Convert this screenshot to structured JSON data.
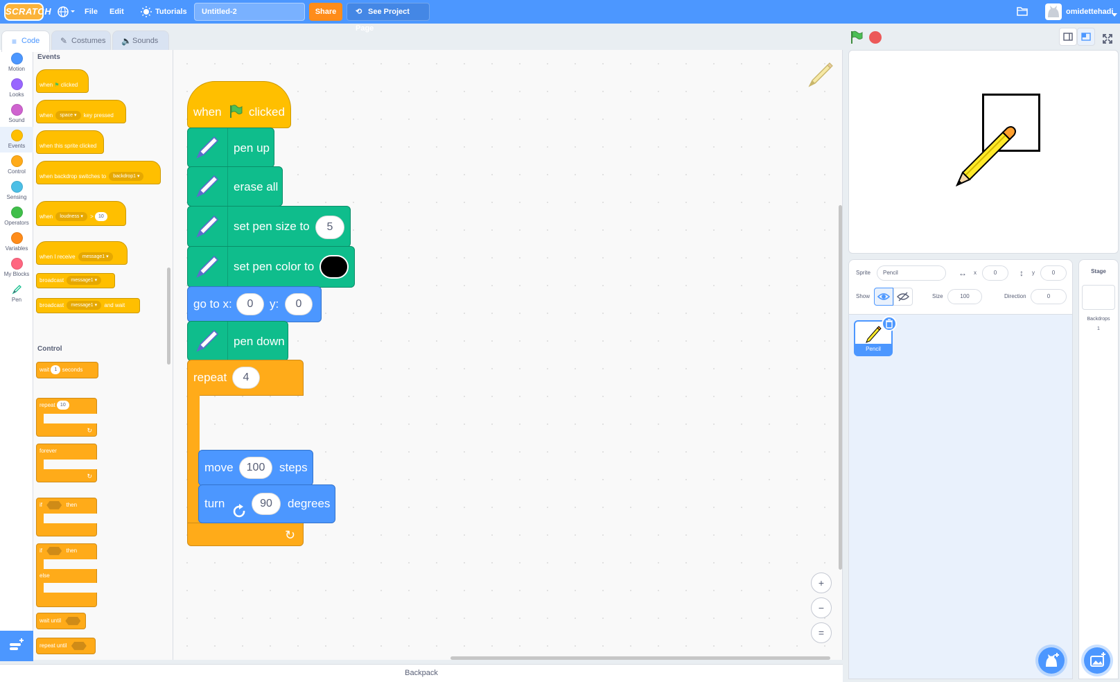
{
  "menu": {
    "logo": "SCRATCH",
    "file": "File",
    "edit": "Edit",
    "tutorials": "Tutorials",
    "project_title": "Untitled-2",
    "share": "Share",
    "see_project": "See Project Page",
    "username": "omidettehadi"
  },
  "tabs": {
    "code": "Code",
    "costumes": "Costumes",
    "sounds": "Sounds"
  },
  "categories": [
    {
      "label": "Motion",
      "color": "#4c97ff"
    },
    {
      "label": "Looks",
      "color": "#9966ff"
    },
    {
      "label": "Sound",
      "color": "#cf63cf"
    },
    {
      "label": "Events",
      "color": "#ffbf00"
    },
    {
      "label": "Control",
      "color": "#ffab19"
    },
    {
      "label": "Sensing",
      "color": "#4cbfe6"
    },
    {
      "label": "Operators",
      "color": "#40bf4a"
    },
    {
      "label": "Variables",
      "color": "#ff8c1a"
    },
    {
      "label": "My Blocks",
      "color": "#ff6680"
    },
    {
      "label": "Pen",
      "color": "#0fbd8c"
    }
  ],
  "palette": {
    "events_header": "Events",
    "control_header": "Control",
    "when": "when",
    "clicked": "clicked",
    "space": "space",
    "key_pressed": "key pressed",
    "when_sprite_clicked": "when this sprite clicked",
    "when_backdrop": "when backdrop switches to",
    "backdrop1": "backdrop1",
    "loudness": "loudness",
    "gt": ">",
    "ten": "10",
    "when_receive": "when I receive",
    "message1": "message1",
    "broadcast": "broadcast",
    "and_wait": "and wait",
    "wait": "wait",
    "one": "1",
    "seconds": "seconds",
    "repeat": "repeat",
    "forever": "forever",
    "if": "if",
    "then": "then",
    "else": "else",
    "wait_until": "wait until",
    "repeat_until": "repeat until"
  },
  "script": {
    "when": "when",
    "clicked": "clicked",
    "pen_up": "pen up",
    "erase_all": "erase all",
    "set_pen_size": "set pen size to",
    "pen_size_value": "5",
    "set_pen_color": "set pen color to",
    "pen_color": "#000000",
    "go_to_x": "go to x:",
    "x_value": "0",
    "y_label": "y:",
    "y_value": "0",
    "pen_down": "pen down",
    "repeat": "repeat",
    "repeat_count": "4",
    "move": "move",
    "move_steps": "100",
    "steps": "steps",
    "turn": "turn",
    "turn_degrees": "90",
    "degrees": "degrees"
  },
  "zoom": {
    "in": "+",
    "out": "−",
    "reset": "="
  },
  "backpack": "Backpack",
  "sprite_info": {
    "sprite_label": "Sprite",
    "sprite_name": "Pencil",
    "x_label": "x",
    "x": "0",
    "y_label": "y",
    "y": "0",
    "show_label": "Show",
    "size_label": "Size",
    "size": "100",
    "direction_label": "Direction",
    "direction": "0"
  },
  "sprites": [
    {
      "name": "Pencil"
    }
  ],
  "stage_panel": {
    "title": "Stage",
    "backdrops_label": "Backdrops",
    "backdrops_count": "1"
  }
}
